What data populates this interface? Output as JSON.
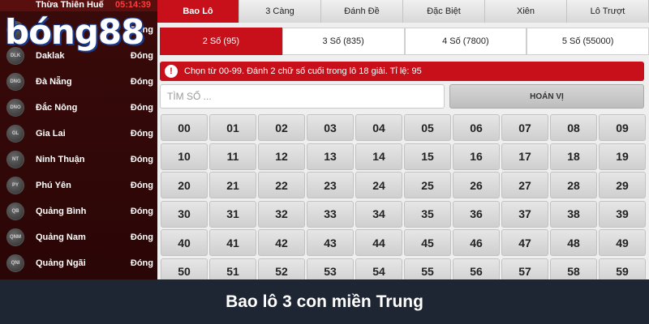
{
  "sidebar": {
    "header_region": "Thừa Thiên Huế",
    "header_time": "05:14:39",
    "logo_text": "bóng88",
    "items": [
      {
        "code": "BD",
        "name": "",
        "status": "Đóng"
      },
      {
        "code": "DLK",
        "name": "Daklak",
        "status": "Đóng"
      },
      {
        "code": "DNG",
        "name": "Đà Nẵng",
        "status": "Đóng"
      },
      {
        "code": "DNO",
        "name": "Đắc Nông",
        "status": "Đóng"
      },
      {
        "code": "GL",
        "name": "Gia Lai",
        "status": "Đóng"
      },
      {
        "code": "NT",
        "name": "Ninh Thuận",
        "status": "Đóng"
      },
      {
        "code": "PY",
        "name": "Phú Yên",
        "status": "Đóng"
      },
      {
        "code": "QB",
        "name": "Quảng Bình",
        "status": "Đóng"
      },
      {
        "code": "QNM",
        "name": "Quảng Nam",
        "status": "Đóng"
      },
      {
        "code": "QNI",
        "name": "Quảng Ngãi",
        "status": "Đóng"
      }
    ]
  },
  "tabs": [
    {
      "label": "Bao Lô",
      "active": true
    },
    {
      "label": "3 Càng",
      "active": false
    },
    {
      "label": "Đánh Đề",
      "active": false
    },
    {
      "label": "Đặc Biệt",
      "active": false
    },
    {
      "label": "Xiên",
      "active": false
    },
    {
      "label": "Lô Trượt",
      "active": false
    }
  ],
  "subtabs": [
    {
      "label": "2 Số (95)",
      "active": true
    },
    {
      "label": "3 Số (835)",
      "active": false
    },
    {
      "label": "4 Số (7800)",
      "active": false
    },
    {
      "label": "5 Số (55000)",
      "active": false
    }
  ],
  "notice": {
    "icon": "alert-icon",
    "text": "Chọn từ 00-99. Đánh 2 chữ số cuối trong lô 18 giải. Tỉ lệ: 95"
  },
  "search": {
    "placeholder": "TÌM SỐ ...",
    "value": ""
  },
  "swap_button": {
    "label": "HOÁN VỊ"
  },
  "numbers": [
    "00",
    "01",
    "02",
    "03",
    "04",
    "05",
    "06",
    "07",
    "08",
    "09",
    "10",
    "11",
    "12",
    "13",
    "14",
    "15",
    "16",
    "17",
    "18",
    "19",
    "20",
    "21",
    "22",
    "23",
    "24",
    "25",
    "26",
    "27",
    "28",
    "29",
    "30",
    "31",
    "32",
    "33",
    "34",
    "35",
    "36",
    "37",
    "38",
    "39",
    "40",
    "41",
    "42",
    "43",
    "44",
    "45",
    "46",
    "47",
    "48",
    "49",
    "50",
    "51",
    "52",
    "53",
    "54",
    "55",
    "56",
    "57",
    "58",
    "59"
  ],
  "caption": "Bao lô 3 con miền Trung",
  "colors": {
    "accent": "#c8101a",
    "sidebar_bg": "#2a0606",
    "caption_bg": "#1e2633"
  }
}
